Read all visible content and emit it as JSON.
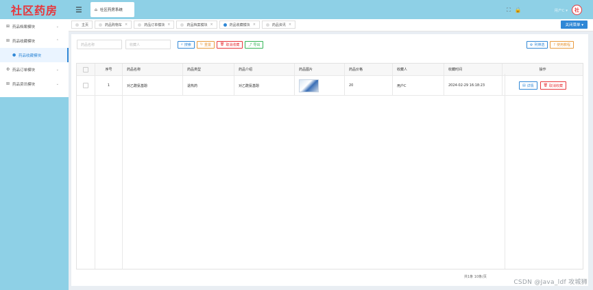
{
  "app": {
    "logo": "社区药房"
  },
  "sidebar": {
    "items": [
      {
        "label": "药品档案模块",
        "icon": "grid-icon",
        "chevron": "⌄"
      },
      {
        "label": "药品收藏模块",
        "icon": "grid-icon",
        "chevron": "⌃"
      },
      {
        "label": "药品收藏模块",
        "icon": "circle-icon",
        "sub": true
      },
      {
        "label": "药品订单模块",
        "icon": "gear-icon",
        "chevron": "⌄"
      },
      {
        "label": "药品资讯模块",
        "icon": "grid-icon",
        "chevron": "⌄"
      }
    ]
  },
  "header": {
    "home_tab": "社区药房系统",
    "user_label": "用户C ▾",
    "avatar_text": "社"
  },
  "tabs": [
    {
      "label": "主页"
    },
    {
      "label": "药品购物车"
    },
    {
      "label": "药品订单模块"
    },
    {
      "label": "药品档案模块"
    },
    {
      "label": "药品收藏模块",
      "active": true
    },
    {
      "label": "药品资讯"
    }
  ],
  "close_menu_label": "关闭菜单 ▾",
  "toolbar": {
    "search_placeholder_1": "药品名称",
    "search_placeholder_2": "收藏人",
    "search": "搜索",
    "reset": "重置",
    "cancel_fav": "取消收藏",
    "export": "导出",
    "filter": "列筛选",
    "tutorial": "使用教程"
  },
  "table": {
    "headers": [
      "",
      "序号",
      "药品名称",
      "药品类型",
      "药品介绍",
      "药品图片",
      "药品价格",
      "收藏人",
      "收藏时间",
      "操作"
    ],
    "rows": [
      {
        "index": "1",
        "name": "对乙酰氨基酚",
        "type": "退热药",
        "intro": "对乙酰氨基酚",
        "price": "20",
        "user": "用户C",
        "time": "2024-02-29 16:18:23"
      }
    ],
    "action_detail": "详情",
    "action_cancel": "取消收藏"
  },
  "pager": {
    "text": "共1条  10条/页"
  },
  "footer": {
    "watermark": "CSDN @Java_ldf 攻城狮"
  },
  "colors": {
    "accent": "#2f87d6",
    "sidebar": "#8ed0e6",
    "danger": "#e8353a",
    "warning": "#e89a3c",
    "success": "#34b455"
  }
}
